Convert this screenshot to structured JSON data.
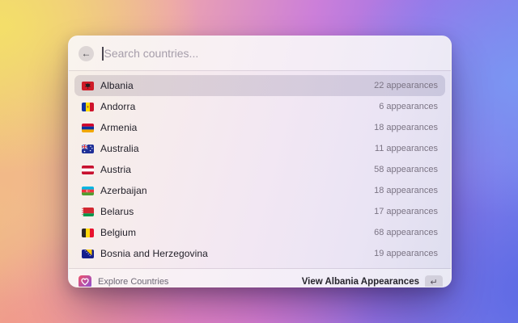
{
  "search": {
    "placeholder": "Search countries...",
    "value": ""
  },
  "header": {
    "back_icon": "←"
  },
  "rows": [
    {
      "country": "Albania",
      "meta": "22 appearances",
      "flag": "albania",
      "selected": true
    },
    {
      "country": "Andorra",
      "meta": "6 appearances",
      "flag": "andorra",
      "selected": false
    },
    {
      "country": "Armenia",
      "meta": "18 appearances",
      "flag": "armenia",
      "selected": false
    },
    {
      "country": "Australia",
      "meta": "11 appearances",
      "flag": "australia",
      "selected": false
    },
    {
      "country": "Austria",
      "meta": "58 appearances",
      "flag": "austria",
      "selected": false
    },
    {
      "country": "Azerbaijan",
      "meta": "18 appearances",
      "flag": "azerbaijan",
      "selected": false
    },
    {
      "country": "Belarus",
      "meta": "17 appearances",
      "flag": "belarus",
      "selected": false
    },
    {
      "country": "Belgium",
      "meta": "68 appearances",
      "flag": "belgium",
      "selected": false
    },
    {
      "country": "Bosnia and Herzegovina",
      "meta": "19 appearances",
      "flag": "bosnia-and-herzegovina",
      "selected": false
    }
  ],
  "footer": {
    "app_label": "Explore Countries",
    "action_label": "View Albania Appearances",
    "key_hint": "↵"
  },
  "colors": {
    "selection": "#d3ccdc",
    "app_icon_gradient_start": "#ef5368",
    "app_icon_gradient_end": "#8a4fd8"
  }
}
